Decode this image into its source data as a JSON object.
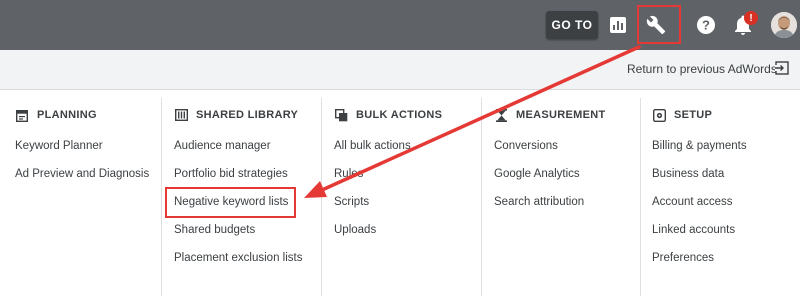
{
  "topbar": {
    "goto_label": "GO TO",
    "icons": [
      "reports-icon",
      "tools-icon",
      "help-icon",
      "notifications-icon"
    ],
    "notification_badge": "!"
  },
  "subbar": {
    "return_label": "Return to previous AdWords"
  },
  "columns": [
    {
      "heading": "PLANNING",
      "icon": "calendar-icon",
      "items": [
        "Keyword Planner",
        "Ad Preview and Diagnosis"
      ]
    },
    {
      "heading": "SHARED LIBRARY",
      "icon": "library-icon",
      "items": [
        "Audience manager",
        "Portfolio bid strategies",
        "Negative keyword lists",
        "Shared budgets",
        "Placement exclusion lists"
      ]
    },
    {
      "heading": "BULK ACTIONS",
      "icon": "copy-icon",
      "items": [
        "All bulk actions",
        "Rules",
        "Scripts",
        "Uploads"
      ]
    },
    {
      "heading": "MEASUREMENT",
      "icon": "hourglass-icon",
      "items": [
        "Conversions",
        "Google Analytics",
        "Search attribution"
      ]
    },
    {
      "heading": "SETUP",
      "icon": "settings-icon",
      "items": [
        "Billing & payments",
        "Business data",
        "Account access",
        "Linked accounts",
        "Preferences"
      ]
    }
  ],
  "annotation_color": "#e53935"
}
